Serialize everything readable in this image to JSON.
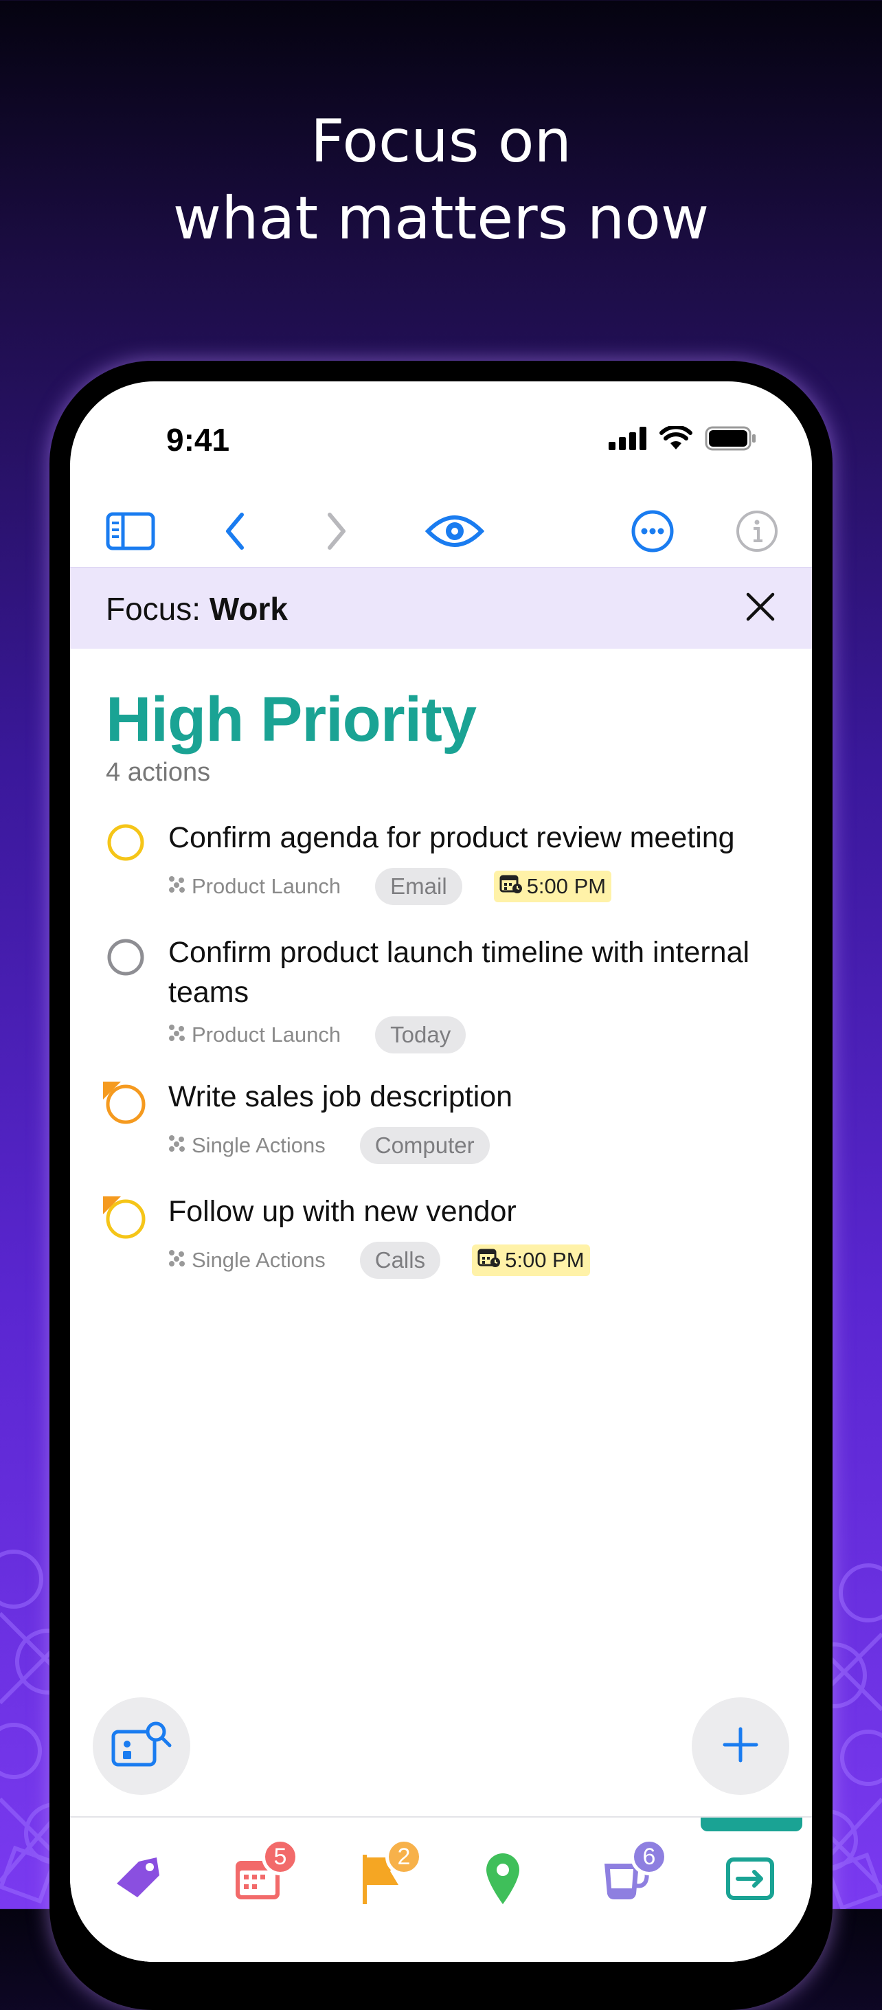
{
  "headline": {
    "line1": "Focus on",
    "line2": "what matters now"
  },
  "status_bar": {
    "time": "9:41"
  },
  "toolbar": {
    "sidebar_icon": "sidebar-icon",
    "back_icon": "chevron-left-icon",
    "forward_icon": "chevron-right-icon",
    "view_icon": "eye-icon",
    "more_icon": "ellipsis-circle-icon",
    "info_icon": "info-circle-icon"
  },
  "focus": {
    "prefix": "Focus:",
    "name": "Work"
  },
  "perspective": {
    "title": "High Priority",
    "count_label": "4 actions"
  },
  "tasks": [
    {
      "text": "Confirm agenda for product review meeting",
      "project": "Product Launch",
      "tag": "Email",
      "due": "5:00 PM",
      "status": "due-soon",
      "flagged": false
    },
    {
      "text": "Confirm product launch timeline with internal teams",
      "project": "Product Launch",
      "tag": "Today",
      "due": "",
      "status": "available",
      "flagged": false
    },
    {
      "text": "Write sales job description",
      "project": "Single Actions",
      "tag": "Computer",
      "due": "",
      "status": "flagged",
      "flagged": true
    },
    {
      "text": "Follow up with new vendor",
      "project": "Single Actions",
      "tag": "Calls",
      "due": "5:00 PM",
      "status": "due-soon",
      "flagged": true
    }
  ],
  "tabbar": {
    "items": [
      {
        "name": "tags",
        "icon": "tag-icon",
        "badge": ""
      },
      {
        "name": "forecast",
        "icon": "calendar-icon",
        "badge": "5"
      },
      {
        "name": "flagged",
        "icon": "flag-icon",
        "badge": "2"
      },
      {
        "name": "nearby",
        "icon": "location-pin-icon",
        "badge": ""
      },
      {
        "name": "review",
        "icon": "coffee-cup-icon",
        "badge": "6"
      },
      {
        "name": "inbox",
        "icon": "inbox-arrow-icon",
        "badge": ""
      }
    ]
  },
  "colors": {
    "accent_blue": "#1a7cf0",
    "perspective_teal": "#1aa394",
    "due_yellow": "#fff2a8",
    "flag_orange": "#f5a623",
    "badge_red": "#f26a6a",
    "badge_orange": "#f7b14a",
    "badge_purple": "#8e7fe0"
  }
}
